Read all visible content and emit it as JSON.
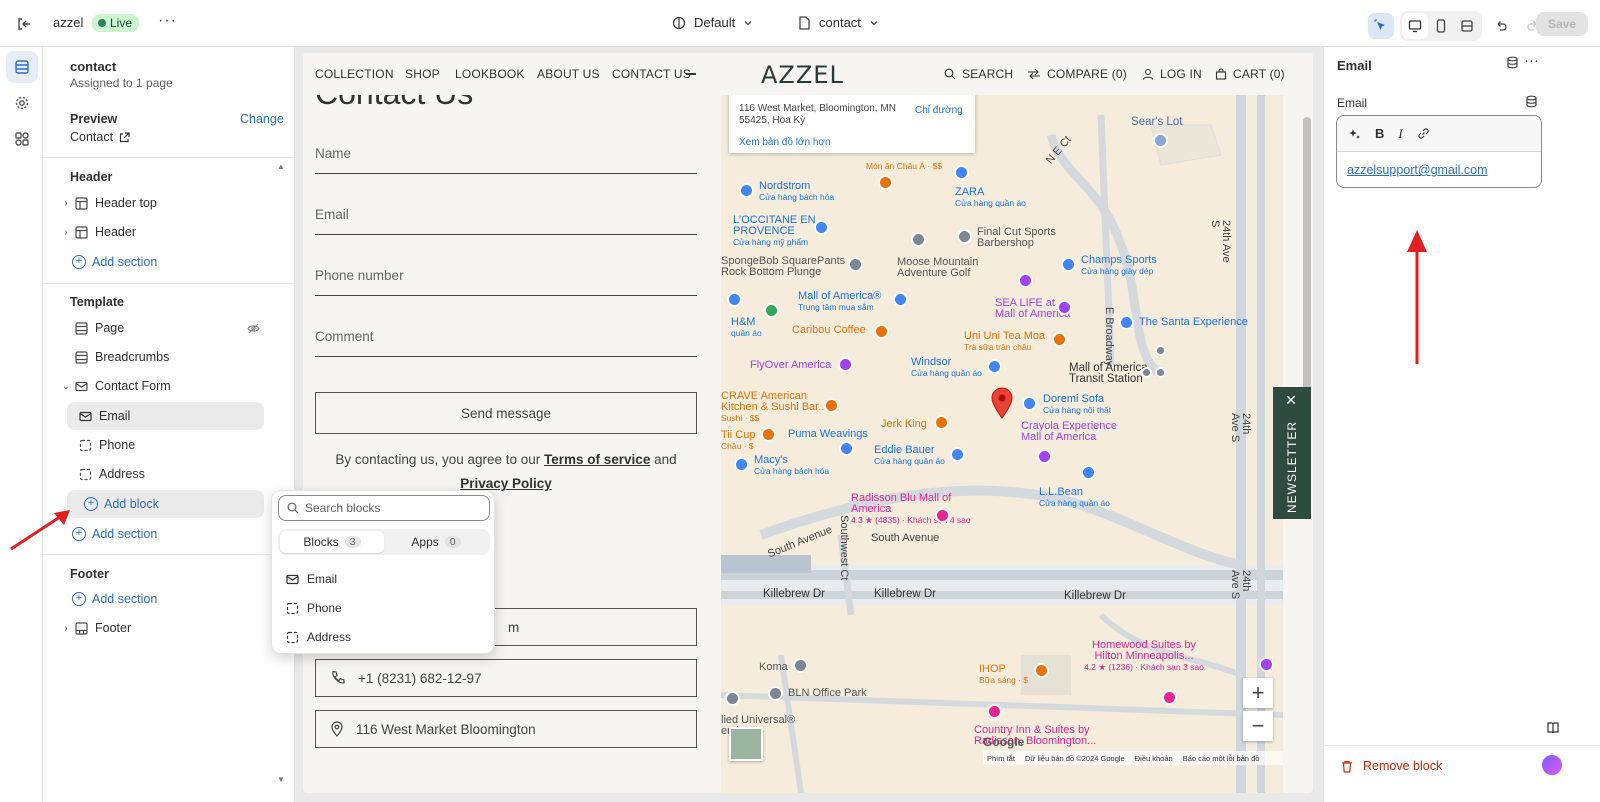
{
  "topbar": {
    "store_name": "azzel",
    "status": "Live",
    "more": "···",
    "theme": "Default",
    "page": "contact",
    "save": "Save"
  },
  "sidebar": {
    "title": "contact",
    "subtitle": "Assigned to 1 page",
    "preview_label": "Preview",
    "change": "Change",
    "preview_value": "Contact",
    "header_heading": "Header",
    "header_items": [
      "Header top",
      "Header"
    ],
    "add_section": "Add section",
    "template_heading": "Template",
    "template_items": [
      "Page",
      "Breadcrumbs",
      "Contact Form"
    ],
    "form_blocks": [
      "Email",
      "Phone",
      "Address"
    ],
    "add_block": "Add block",
    "footer_heading": "Footer",
    "footer_item": "Footer"
  },
  "popup": {
    "search_placeholder": "Search blocks",
    "tab_blocks": "Blocks",
    "tab_blocks_count": "3",
    "tab_apps": "Apps",
    "tab_apps_count": "0",
    "items": [
      "Email",
      "Phone",
      "Address"
    ]
  },
  "store": {
    "nav_left": [
      "COLLECTION",
      "SHOP",
      "LOOKBOOK",
      "ABOUT US",
      "CONTACT US"
    ],
    "logo": "AZZEL",
    "nav_right": [
      "SEARCH",
      "COMPARE (0)",
      "LOG IN",
      "CART (0)"
    ],
    "page_title": "Contact Us",
    "fields": [
      "Name",
      "Email",
      "Phone number",
      "Comment"
    ],
    "send": "Send message",
    "agree_pre": "By contacting us, you agree to our ",
    "terms": "Terms of service",
    "agree_and": " and",
    "privacy": "Privacy Policy",
    "info_email_tail": "m",
    "phone": "+1 (8231) 682-12-97",
    "address": "116 West Market Bloomington",
    "newsletter": "NEWSLETTER"
  },
  "map": {
    "card_address": "116 West Market, Bloomington, MN 55425, Hoa Kỳ",
    "card_directions": "Chỉ đường",
    "card_larger": "Xem bản đồ lớn hơn",
    "places": [
      {
        "name": "Sear's Lot",
        "sub": ""
      },
      {
        "name": "Món ăn Châu Á · $$",
        "sub": ""
      },
      {
        "name": "Nordstrom",
        "sub": "Cửa hàng bách hóa"
      },
      {
        "name": "ZARA",
        "sub": "Cửa hàng quần áo"
      },
      {
        "name": "L'OCCITANE EN PROVENCE",
        "sub": "Cửa hàng mỹ phẩm"
      },
      {
        "name": "Final Cut Sports Barbershop",
        "sub": ""
      },
      {
        "name": "SpongeBob SquarePants Rock Bottom Plunge",
        "sub": ""
      },
      {
        "name": "Moose Mountain Adventure Golf",
        "sub": ""
      },
      {
        "name": "Champs Sports",
        "sub": "Cửa hàng giày dép"
      },
      {
        "name": "Mall of America®",
        "sub": "Trung tâm mua sắm"
      },
      {
        "name": "H&M",
        "sub": "quần áo"
      },
      {
        "name": "SEA LIFE at Mall of America",
        "sub": ""
      },
      {
        "name": "The Santa Experience",
        "sub": ""
      },
      {
        "name": "Caribou Coffee",
        "sub": ""
      },
      {
        "name": "Uni Uni Tea Moa",
        "sub": "Trà sữa trân châu"
      },
      {
        "name": "FlyOver America",
        "sub": ""
      },
      {
        "name": "Windsor",
        "sub": "Cửa hàng quần áo"
      },
      {
        "name": "Mall of America Transit Station",
        "sub": ""
      },
      {
        "name": "CRAVE American Kitchen & Sushi Bar...",
        "sub": "Sushi · $$"
      },
      {
        "name": "Doremi Sofa",
        "sub": "Cửa hàng nội thất"
      },
      {
        "name": "Jerk King",
        "sub": ""
      },
      {
        "name": "Tii Cup",
        "sub": "Châu · $"
      },
      {
        "name": "Puma Weavings",
        "sub": ""
      },
      {
        "name": "Crayola Experience Mall of America",
        "sub": ""
      },
      {
        "name": "Eddie Bauer",
        "sub": "Cửa hàng quần áo"
      },
      {
        "name": "Macy's",
        "sub": "Cửa hàng bách hóa"
      },
      {
        "name": "L.L.Bean",
        "sub": "Cửa hàng quần áo"
      },
      {
        "name": "Radisson Blu Mall of America",
        "sub": "4.3 ★ (4835) · Khách sạn 4 sao"
      },
      {
        "name": "South Avenue",
        "sub": ""
      },
      {
        "name": "Killebrew Dr",
        "sub": ""
      },
      {
        "name": "Homewood Suites by Hilton Minneapolis...",
        "sub": "4.2 ★ (1236) · Khách sạn 3 sao"
      },
      {
        "name": "IHOP",
        "sub": "Bữa sáng · $"
      },
      {
        "name": "Koma",
        "sub": ""
      },
      {
        "name": "BLN Office Park",
        "sub": ""
      },
      {
        "name": "Country Inn & Suites by Radisson, Bloomington...",
        "sub": ""
      },
      {
        "name": "lied Universal® ervices",
        "sub": ""
      }
    ],
    "roads": [
      "24th Ave S",
      "E Broadway",
      "N E Ct",
      "Southwest Ct"
    ],
    "footer": [
      "Phím tắt",
      "Dữ liệu bản đồ ©2024 Google",
      "Điều khoản",
      "Báo cáo một lỗi bản đồ"
    ],
    "google": "Google"
  },
  "rightpanel": {
    "title": "Email",
    "field_label": "Email",
    "toolbar": [
      "B",
      "I"
    ],
    "email": "azzelsupport@gmail.com",
    "remove": "Remove block"
  },
  "colors": {
    "accent": "#2c6ecb",
    "live_bg": "#cdf5cf",
    "danger": "#c5280c",
    "newsletter_bg": "#2f4a3f",
    "annotation_arrow": "#e02020"
  }
}
